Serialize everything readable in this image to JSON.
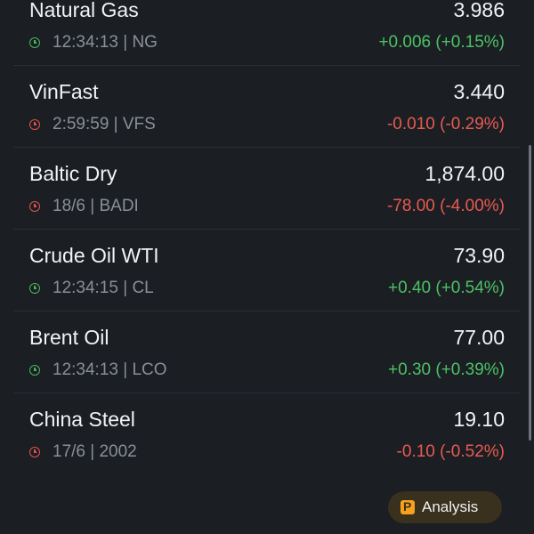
{
  "instruments": [
    {
      "name": "Natural Gas",
      "price": "3.986",
      "time": "12:34:13 | NG",
      "change": "+0.006 (+0.15%)",
      "direction": "up"
    },
    {
      "name": "VinFast",
      "price": "3.440",
      "time": "2:59:59 | VFS",
      "change": "-0.010 (-0.29%)",
      "direction": "down"
    },
    {
      "name": "Baltic Dry",
      "price": "1,874.00",
      "time": "18/6 | BADI",
      "change": "-78.00 (-4.00%)",
      "direction": "down"
    },
    {
      "name": "Crude Oil WTI",
      "price": "73.90",
      "time": "12:34:15 | CL",
      "change": "+0.40 (+0.54%)",
      "direction": "up"
    },
    {
      "name": "Brent Oil",
      "price": "77.00",
      "time": "12:34:13 | LCO",
      "change": "+0.30 (+0.39%)",
      "direction": "up"
    },
    {
      "name": "China Steel",
      "price": "19.10",
      "time": "17/6 | 2002",
      "change": "-0.10 (-0.52%)",
      "direction": "down"
    }
  ],
  "analysis_button": {
    "label": "Analysis",
    "icon": "analysis-logo-icon"
  },
  "colors": {
    "up": "#4cc265",
    "down": "#e85a50",
    "background": "#1b1e23",
    "button_bg": "#39301d",
    "accent": "#f7a21b"
  }
}
